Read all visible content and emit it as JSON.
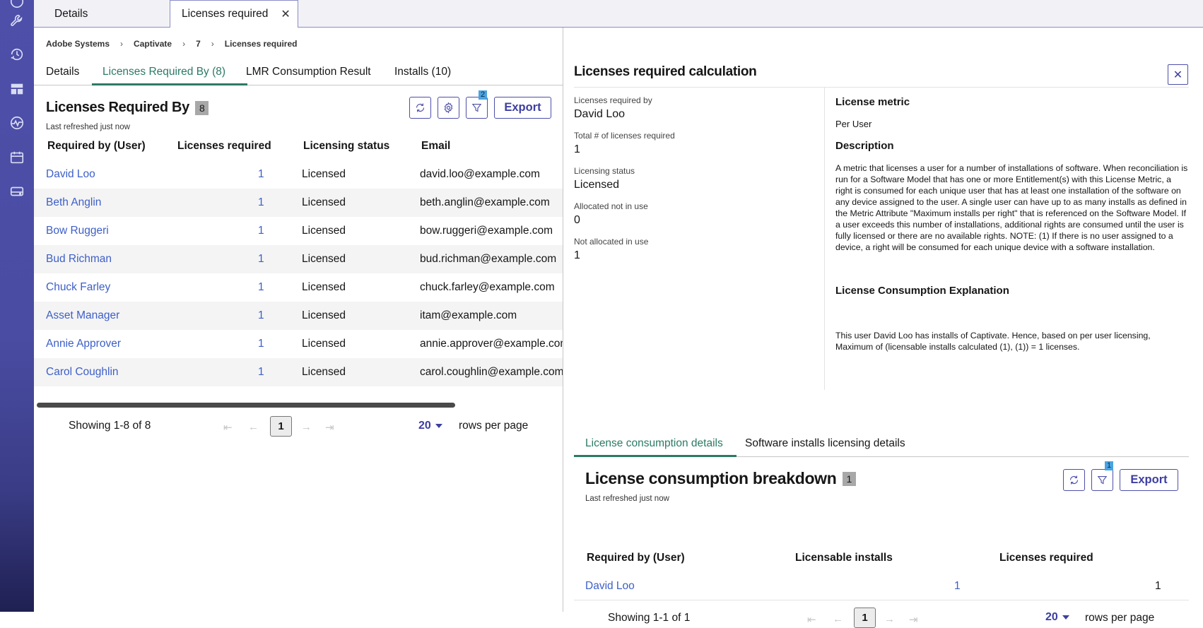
{
  "tabs": [
    {
      "label": "Details"
    },
    {
      "label": "Licenses required"
    }
  ],
  "breadcrumb": [
    "Adobe Systems",
    "Captivate",
    "7",
    "Licenses required"
  ],
  "subtabs": [
    "Details",
    "Licenses Required By (8)",
    "LMR Consumption Result",
    "Installs (10)"
  ],
  "left": {
    "title": "Licenses Required By",
    "count": "8",
    "refreshed": "Last refreshed just now",
    "filter_badge": "2",
    "export_label": "Export",
    "columns": [
      "Required by (User)",
      "Licenses required",
      "Licensing status",
      "Email"
    ],
    "rows": [
      {
        "user": "David Loo",
        "licenses": "1",
        "status": "Licensed",
        "email": "david.loo@example.com"
      },
      {
        "user": "Beth Anglin",
        "licenses": "1",
        "status": "Licensed",
        "email": "beth.anglin@example.com"
      },
      {
        "user": "Bow Ruggeri",
        "licenses": "1",
        "status": "Licensed",
        "email": "bow.ruggeri@example.com"
      },
      {
        "user": "Bud Richman",
        "licenses": "1",
        "status": "Licensed",
        "email": "bud.richman@example.com"
      },
      {
        "user": "Chuck Farley",
        "licenses": "1",
        "status": "Licensed",
        "email": "chuck.farley@example.com"
      },
      {
        "user": "Asset Manager",
        "licenses": "1",
        "status": "Licensed",
        "email": "itam@example.com"
      },
      {
        "user": "Annie Approver",
        "licenses": "1",
        "status": "Licensed",
        "email": "annie.approver@example.com"
      },
      {
        "user": "Carol Coughlin",
        "licenses": "1",
        "status": "Licensed",
        "email": "carol.coughlin@example.com"
      }
    ],
    "pager": {
      "showing": "Showing 1-8 of 8",
      "page": "1",
      "rows_value": "20",
      "rows_label": "rows per page"
    }
  },
  "right": {
    "title": "Licenses required calculation",
    "fields": [
      {
        "label": "Licenses required by",
        "value": "David Loo"
      },
      {
        "label": "Total # of licenses required",
        "value": "1"
      },
      {
        "label": "Licensing status",
        "value": "Licensed"
      },
      {
        "label": "Allocated not in use",
        "value": "0"
      },
      {
        "label": "Not allocated in use",
        "value": "1"
      }
    ],
    "metric_heading": "License metric",
    "metric_value": "Per User",
    "description_heading": "Description",
    "description": "A metric that licenses a user for a number of installations of software. When reconciliation is run for a Software Model that has one or more Entitlement(s) with this License Metric, a right is consumed for each unique user that has at least one installation of the software on any device assigned to the user. A single user can have up to as many installs as defined in the Metric Attribute \"Maximum installs per right\" that is referenced on the Software Model. If a user exceeds this number of installations, additional rights are consumed until the user is fully licensed or there are no available rights. NOTE: (1) If there is no user assigned to a device, a right will be consumed for each unique device with a software installation.",
    "explanation_heading": "License Consumption Explanation",
    "explanation": "This user David Loo has installs of Captivate. Hence, based on per user licensing, Maximum of (licensable installs calculated (1), (1)) = 1 licenses.",
    "bottom_tabs": [
      "License consumption details",
      "Software installs licensing details"
    ],
    "breakdown": {
      "title": "License consumption breakdown",
      "count": "1",
      "refreshed": "Last refreshed just now",
      "filter_badge": "1",
      "export_label": "Export",
      "columns": [
        "Required by (User)",
        "Licensable installs",
        "Licenses required"
      ],
      "row": {
        "user": "David Loo",
        "installs": "1",
        "licenses": "1"
      },
      "pager": {
        "showing": "Showing 1-1 of 1",
        "page": "1",
        "rows_value": "20",
        "rows_label": "rows per page"
      }
    }
  },
  "colors": {
    "brand": "#4d4fa9",
    "link": "#3d5fc8",
    "active_tab": "#2b7a65",
    "badge": "#4aa3e0"
  },
  "sidebar_icons": [
    "wrench-icon",
    "history-icon",
    "dashboard-icon",
    "activity-icon",
    "calendar-icon",
    "storage-icon"
  ]
}
